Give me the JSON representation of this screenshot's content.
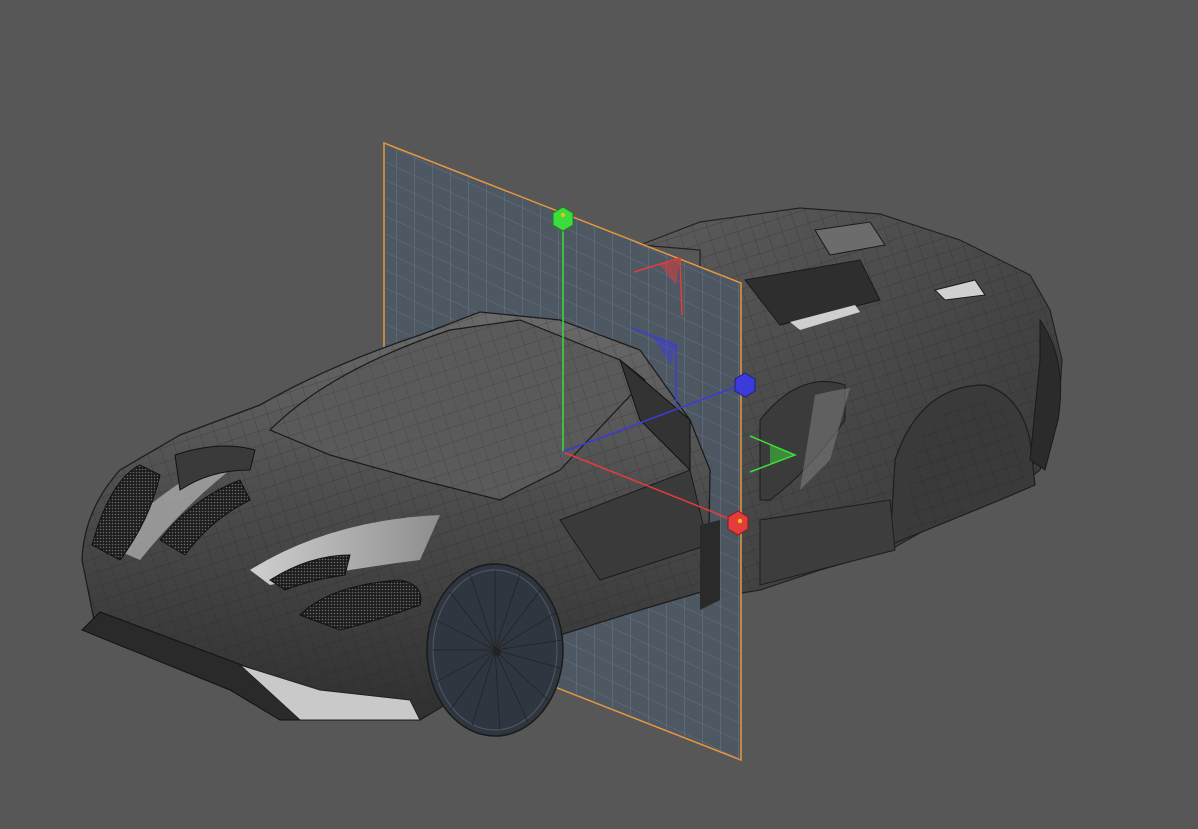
{
  "viewport": {
    "background": "#575757",
    "model": "car-body-wireframe",
    "body_color": "#4a4a4a",
    "wire_color": "#1a1a1a",
    "highlight_color": "#d9d9d9"
  },
  "section_plane": {
    "border_color": "#e8973a",
    "fill_color": "#4d5864",
    "grid_color": "#6f7b87"
  },
  "gizmo": {
    "x_axis_color": "#e53b3b",
    "y_axis_color": "#3bdc3b",
    "z_axis_color": "#3b3bdc",
    "handles": [
      "x-axis-handle",
      "y-axis-handle",
      "z-axis-handle"
    ]
  }
}
